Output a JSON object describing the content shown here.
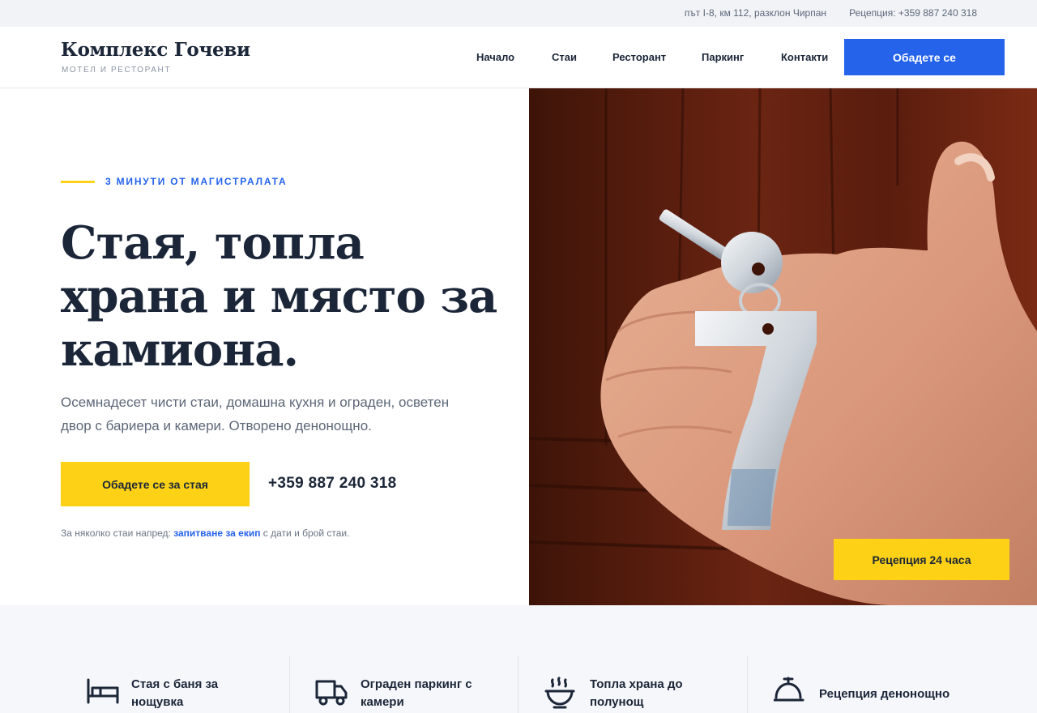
{
  "topbar": {
    "address": "път I-8, км 112, разклон Чирпан",
    "reception": "Рецепция: +359 887 240 318"
  },
  "header": {
    "logo_title": "Комплекс Гочеви",
    "logo_subtitle": "МОТЕЛ И РЕСТОРАНТ",
    "nav": [
      "Начало",
      "Стаи",
      "Ресторант",
      "Паркинг",
      "Контакти"
    ],
    "cta_label": "Обадете се"
  },
  "hero": {
    "eyebrow": "3 МИНУТИ ОТ МАГИСТРАЛАТА",
    "title": "Стая, топла храна и място за камиона.",
    "description": "Осемнадесет чисти стаи, домашна кухня и ограден, осветен двор с бариера и камери. Отворено денонощно.",
    "cta_label": "Обадете се за стая",
    "phone": "+359 887 240 318",
    "note_prefix": "За няколко стаи напред: ",
    "note_link": "запитване за екип",
    "note_suffix": " с дати и брой стаи.",
    "photo_badge": "Рецепция 24 часа"
  },
  "features": [
    {
      "icon": "bed-icon",
      "label": "Стая с баня за нощувка"
    },
    {
      "icon": "truck-icon",
      "label": "Ограден паркинг с камери"
    },
    {
      "icon": "bowl-icon",
      "label": "Топла храна до полунощ"
    },
    {
      "icon": "bell-icon",
      "label": "Рецепция денонощно"
    }
  ],
  "colors": {
    "accent_blue": "#2563eb",
    "accent_yellow": "#fcd116",
    "text_dark": "#1b2638",
    "wood": "#6b2412"
  }
}
